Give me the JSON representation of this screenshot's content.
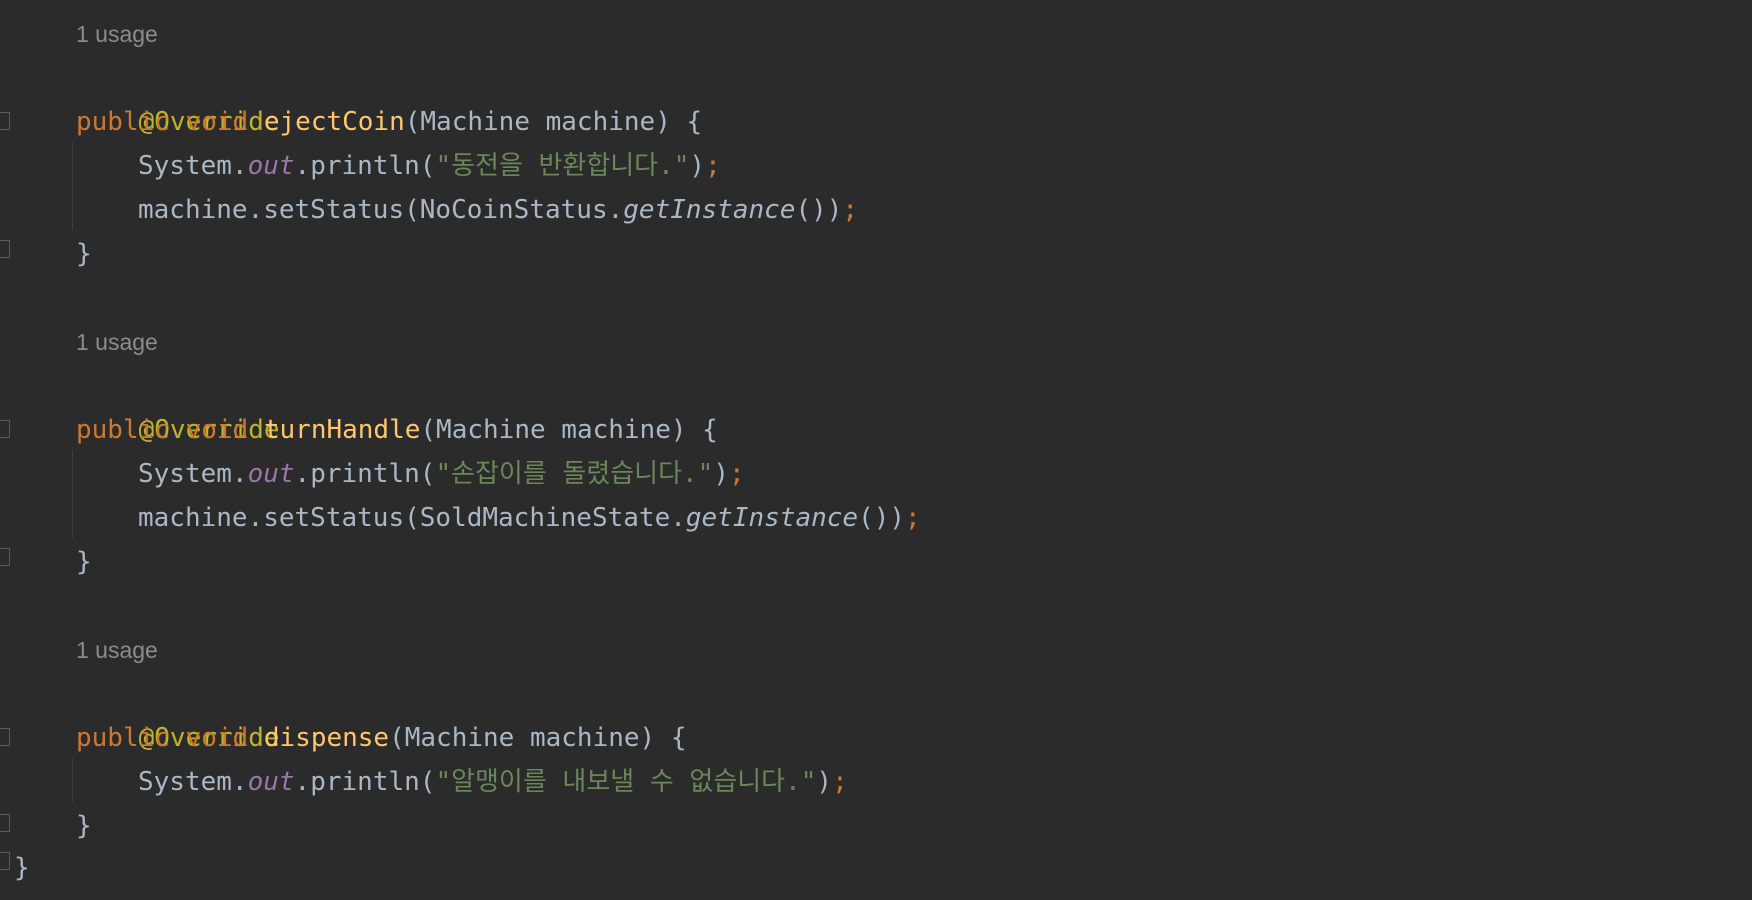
{
  "editor": {
    "usage_hint": "1 usage",
    "annotation": "@Override",
    "kw_public": "public",
    "kw_void": "void",
    "param_list": "(Machine machine) {",
    "system": "System.",
    "out": "out",
    "println_open": ".println(",
    "machine_set": "machine.setStatus(",
    "get_instance": "getInstance",
    "call_close": "())",
    "print_close": ")",
    "semicolon": ";",
    "method_close": "}",
    "class_close": "}",
    "methods": [
      {
        "name": "ejectCoin",
        "message": "\"동전을 반환합니다.\"",
        "state_class": "NoCoinStatus."
      },
      {
        "name": "turnHandle",
        "message": "\"손잡이를 돌렸습니다.\"",
        "state_class": "SoldMachineState."
      },
      {
        "name": "dispense",
        "message": "\"알맹이를 내보낼 수 없습니다.\""
      }
    ]
  }
}
